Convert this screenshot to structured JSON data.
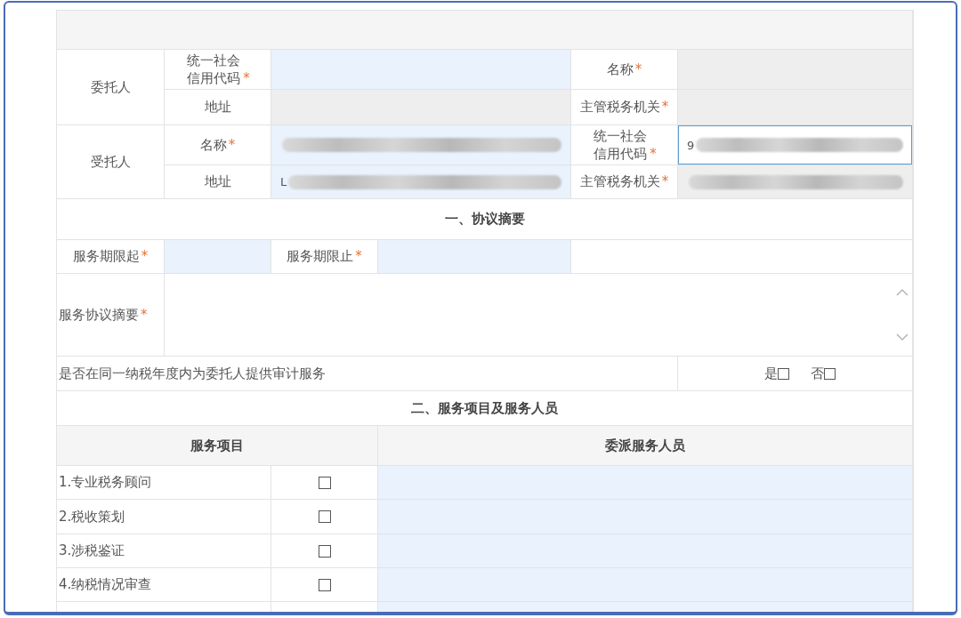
{
  "required_mark": "*",
  "parties": [
    {
      "role": "委托人",
      "fields": [
        {
          "label": "统一社会信用代码",
          "required": true,
          "editable": true
        },
        {
          "label": "名称",
          "required": true,
          "editable": false
        },
        {
          "label": "地址",
          "required": false,
          "editable": false
        },
        {
          "label": "主管税务机关",
          "required": true,
          "editable": false
        }
      ]
    },
    {
      "role": "受托人",
      "fields": [
        {
          "label": "名称",
          "required": true,
          "editable": true,
          "redacted": true
        },
        {
          "label": "统一社会信用代码",
          "required": true,
          "editable": true,
          "focused": true,
          "value": "9",
          "redacted": true
        },
        {
          "label": "地址",
          "required": false,
          "editable": true,
          "value": "L",
          "redacted": true
        },
        {
          "label": "主管税务机关",
          "required": true,
          "editable": false,
          "redacted": true
        }
      ]
    }
  ],
  "section_1": {
    "title": "一、协议摘要",
    "period": [
      {
        "label": "服务期限起",
        "required": true
      },
      {
        "label": "服务期限止",
        "required": true
      }
    ],
    "summary": {
      "label": "服务协议摘要",
      "required": true
    },
    "audit": {
      "question": "是否在同一纳税年度内为委托人提供审计服务",
      "options": [
        {
          "label": "是",
          "checked": false
        },
        {
          "label": "否",
          "checked": false
        }
      ]
    }
  },
  "section_2": {
    "title": "二、服务项目及服务人员",
    "columns": [
      "服务项目",
      "委派服务人员"
    ],
    "items": [
      {
        "label": "1.专业税务顾问",
        "checked": false
      },
      {
        "label": "2.税收策划",
        "checked": false
      },
      {
        "label": "3.涉税鉴证",
        "checked": false
      },
      {
        "label": "4.纳税情况审查",
        "checked": false
      }
    ]
  }
}
